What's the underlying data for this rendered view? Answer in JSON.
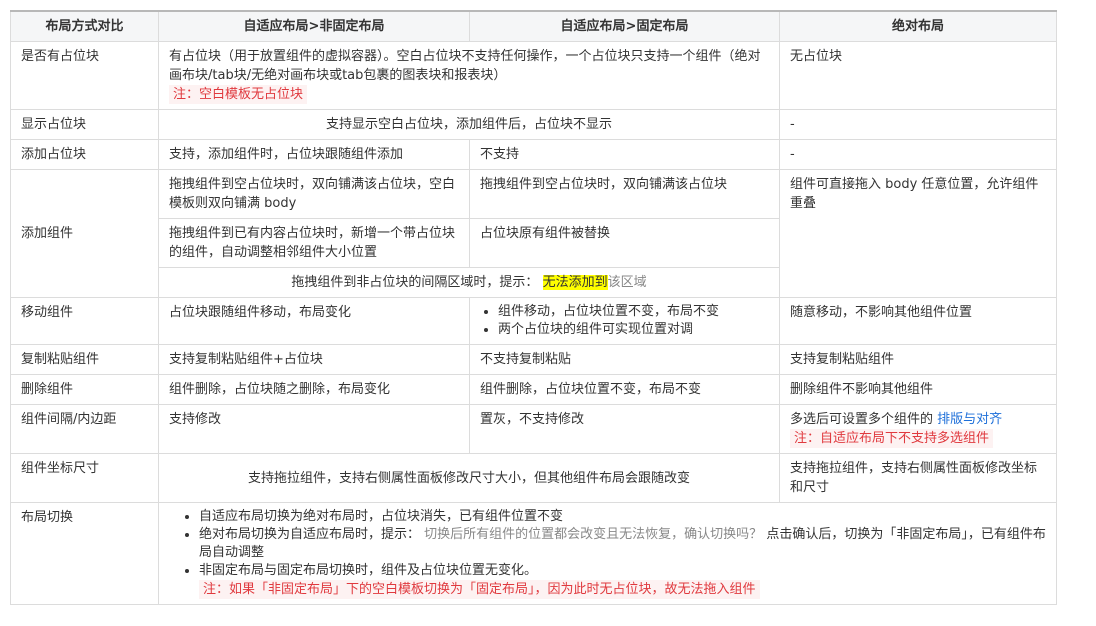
{
  "headers": [
    "布局方式对比",
    "自适应布局>非固定布局",
    "自适应布局>固定布局",
    "绝对布局"
  ],
  "rows": {
    "placeholder_exists": {
      "label": "是否有占位块",
      "adaptive_text": "有占位块（用于放置组件的虚拟容器）。空白占位块不支持任何操作，一个占位块只支持一个组件（绝对画布块/tab块/无绝对画布块或tab包裹的图表块和报表块）",
      "adaptive_note": "注：空白模板无占位块",
      "absolute": "无占位块"
    },
    "show_placeholder": {
      "label": "显示占位块",
      "adaptive": "支持显示空白占位块，添加组件后，占位块不显示",
      "absolute": "-"
    },
    "add_placeholder": {
      "label": "添加占位块",
      "nonfixed": "支持，添加组件时，占位块跟随组件添加",
      "fixed": "不支持",
      "absolute": "-"
    },
    "add_component": {
      "label": "添加组件",
      "nonfixed_1": "拖拽组件到空占位块时，双向铺满该占位块，空白模板则双向铺满 body",
      "fixed_1": "拖拽组件到空占位块时，双向铺满该占位块",
      "absolute": "组件可直接拖入 body 任意位置，允许组件重叠",
      "nonfixed_2": "拖拽组件到已有内容占位块时，新增一个带占位块的组件，自动调整相邻组件大小位置",
      "fixed_2": "占位块原有组件被替换",
      "merged_prefix": "拖拽组件到非占位块的间隔区域时，提示：",
      "merged_highlight": "无法添加到",
      "merged_suffix": "该区域"
    },
    "move_component": {
      "label": "移动组件",
      "nonfixed": "占位块跟随组件移动，布局变化",
      "fixed_items": [
        "组件移动，占位块位置不变，布局不变",
        "两个占位块的组件可实现位置对调"
      ],
      "absolute": "随意移动，不影响其他组件位置"
    },
    "copy_paste": {
      "label": "复制粘贴组件",
      "nonfixed": "支持复制粘贴组件+占位块",
      "fixed": "不支持复制粘贴",
      "absolute": "支持复制粘贴组件"
    },
    "delete_component": {
      "label": "删除组件",
      "nonfixed": "组件删除，占位块随之删除，布局变化",
      "fixed": "组件删除，占位块位置不变，布局不变",
      "absolute": "删除组件不影响其他组件"
    },
    "spacing": {
      "label": "组件间隔/内边距",
      "nonfixed": "支持修改",
      "fixed": "置灰，不支持修改",
      "absolute_prefix": "多选后可设置多个组件的",
      "absolute_link": "排版与对齐",
      "absolute_note": "注：自适应布局下不支持多选组件"
    },
    "coords_size": {
      "label": "组件坐标尺寸",
      "adaptive": "支持拖拉组件，支持右侧属性面板修改尺寸大小，但其他组件布局会跟随改变",
      "absolute": "支持拖拉组件，支持右侧属性面板修改坐标和尺寸"
    },
    "switch_layout": {
      "label": "布局切换",
      "item1": "自适应布局切换为绝对布局时，占位块消失，已有组件位置不变",
      "item2_prefix": "绝对布局切换为自适应布局时，提示：",
      "item2_grey": "切换后所有组件的位置都会改变且无法恢复，确认切换吗？",
      "item2_suffix": "点击确认后，切换为「非固定布局」，已有组件布局自动调整",
      "item3": "非固定布局与固定布局切换时，组件及占位块位置无变化。",
      "note": "注：如果「非固定布局」下的空白模板切换为「固定布局」，因为此时无占位块，故无法拖入组件"
    }
  }
}
